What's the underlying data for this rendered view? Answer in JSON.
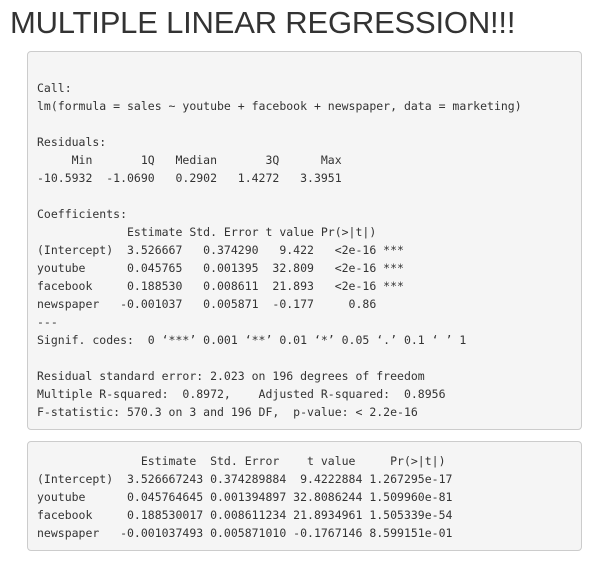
{
  "page": {
    "title": "MULTIPLE LINEAR REGRESSION!!!"
  },
  "summary_output": {
    "lines": [
      "Call:",
      "lm(formula = sales ~ youtube + facebook + newspaper, data = marketing)",
      "",
      "Residuals:",
      "     Min       1Q   Median       3Q      Max ",
      "-10.5932  -1.0690   0.2902   1.4272   3.3951 ",
      "",
      "Coefficients:",
      "             Estimate Std. Error t value Pr(>|t|)    ",
      "(Intercept)  3.526667   0.374290   9.422   <2e-16 ***",
      "youtube      0.045765   0.001395  32.809   <2e-16 ***",
      "facebook     0.188530   0.008611  21.893   <2e-16 ***",
      "newspaper   -0.001037   0.005871  -0.177     0.86    ",
      "---",
      "Signif. codes:  0 ‘***’ 0.001 ‘**’ 0.01 ‘*’ 0.05 ‘.’ 0.1 ‘ ’ 1",
      "",
      "Residual standard error: 2.023 on 196 degrees of freedom",
      "Multiple R-squared:  0.8972,    Adjusted R-squared:  0.8956 ",
      "F-statistic: 570.3 on 3 and 196 DF,  p-value: < 2.2e-16"
    ]
  },
  "coefficient_table": {
    "lines": [
      "               Estimate  Std. Error    t value     Pr(>|t|)",
      "(Intercept)  3.526667243 0.374289884  9.4222884 1.267295e-17",
      "youtube      0.045764645 0.001394897 32.8086244 1.509960e-81",
      "facebook     0.188530017 0.008611234 21.8934961 1.505339e-54",
      "newspaper   -0.001037493 0.005871010 -0.1767146 8.599151e-01"
    ]
  }
}
